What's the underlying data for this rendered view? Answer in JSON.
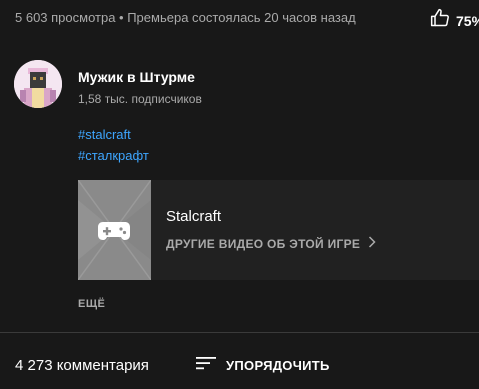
{
  "video": {
    "stats_text": "5 603 просмотра • Премьера состоялась 20 часов назад",
    "like_percent": "75%",
    "like_icon": "thumbs-up-icon"
  },
  "channel": {
    "name": "Мужик в Штурме",
    "subscribers": "1,58 тыс. подписчиков"
  },
  "description": {
    "hashtags": [
      "#stalcraft",
      "#сталкрафт"
    ],
    "show_more_label": "ЕЩЁ"
  },
  "game": {
    "title": "Stalcraft",
    "more_label": "ДРУГИЕ ВИДЕО ОБ ЭТОЙ ИГРЕ",
    "icon": "gamepad-icon"
  },
  "comments": {
    "count_label": "4 273 комментария",
    "sort_label": "УПОРЯДОЧИТЬ",
    "sort_icon": "sort-icon"
  },
  "colors": {
    "background": "#181818",
    "link": "#3ea6ff",
    "secondary_text": "#aaaaaa",
    "card_background": "#212121"
  }
}
